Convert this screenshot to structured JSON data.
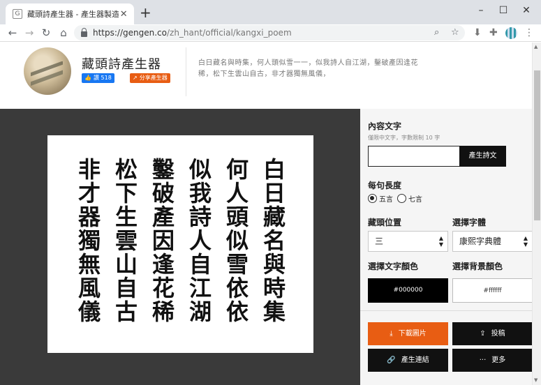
{
  "browser": {
    "tab_title": "藏頭詩產生器 - 產生器製造機⚡",
    "favicon_letter": "G",
    "url_host": "https://gengen.co",
    "url_path": "/zh_hant/official/kangxi_poem"
  },
  "header": {
    "title": "藏頭詩產生器",
    "like_label": "讚 518",
    "share_label": "分享產生器",
    "description": "白日藏名與時集，何人頭似雪一一，似我詩人自江湖，鑿破產因逢花稀，松下生雲山自古，非才器獨無風儀，"
  },
  "poem": {
    "lines": [
      "白日藏名與時集",
      "何人頭似雪依依",
      "似我詩人自江湖",
      "鑿破產因逢花稀",
      "松下生雲山自古",
      "非才器獨無風儀"
    ]
  },
  "panel": {
    "content_label": "內容文字",
    "content_hint": "僅限中文字，字數限制 10 字",
    "content_value": "",
    "generate_label": "產生詩文",
    "length_label": "每句長度",
    "length_options": [
      "五言",
      "七言"
    ],
    "length_selected": "五言",
    "position_label": "藏頭位置",
    "position_value": "三",
    "font_label": "選擇字體",
    "font_value": "康熙字典體",
    "text_color_label": "選擇文字顏色",
    "text_color_value": "#000000",
    "bg_color_label": "選擇背景顏色",
    "bg_color_value": "#ffffff",
    "download_label": "下載圖片",
    "submit_label": "投稿",
    "link_label": "產生連結",
    "more_label": "更多"
  },
  "colors": {
    "accent_orange": "#e85d13",
    "facebook_blue": "#1877f2",
    "dark": "#111111",
    "canvas_bg": "#3a3a3a"
  }
}
